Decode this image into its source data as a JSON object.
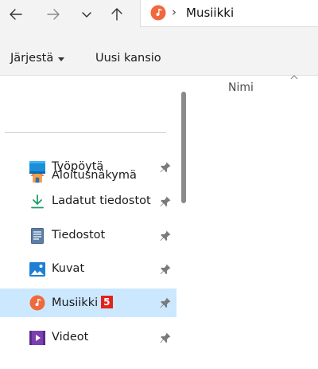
{
  "navbar": {
    "address": "Musiikki",
    "address_separator": "›",
    "icons": {
      "back": "arrow-left-icon",
      "forward": "arrow-right-icon",
      "recent": "chevron-down-icon",
      "up": "arrow-up-icon",
      "location": "music-icon"
    }
  },
  "toolbar": {
    "sort_label": "Järjestä",
    "new_folder_label": "Uusi kansio"
  },
  "sidebar": {
    "home_label": "Aloitusnäkymä",
    "items": [
      {
        "label": "Työpöytä",
        "icon": "desktop-icon",
        "pinned": true
      },
      {
        "label": "Ladatut tiedostot",
        "icon": "download-icon",
        "pinned": true
      },
      {
        "label": "Tiedostot",
        "icon": "document-icon",
        "pinned": true
      },
      {
        "label": "Kuvat",
        "icon": "pictures-icon",
        "pinned": true
      },
      {
        "label": "Musiikki",
        "icon": "music-icon",
        "pinned": true,
        "selected": true,
        "badge": "5"
      },
      {
        "label": "Videot",
        "icon": "videos-icon",
        "pinned": true
      }
    ]
  },
  "content": {
    "column_name": "Nimi"
  },
  "colors": {
    "selection": "#cce8ff",
    "accent": "#0078d4",
    "badge": "#e2231a",
    "music_icon": "#f0693c"
  }
}
